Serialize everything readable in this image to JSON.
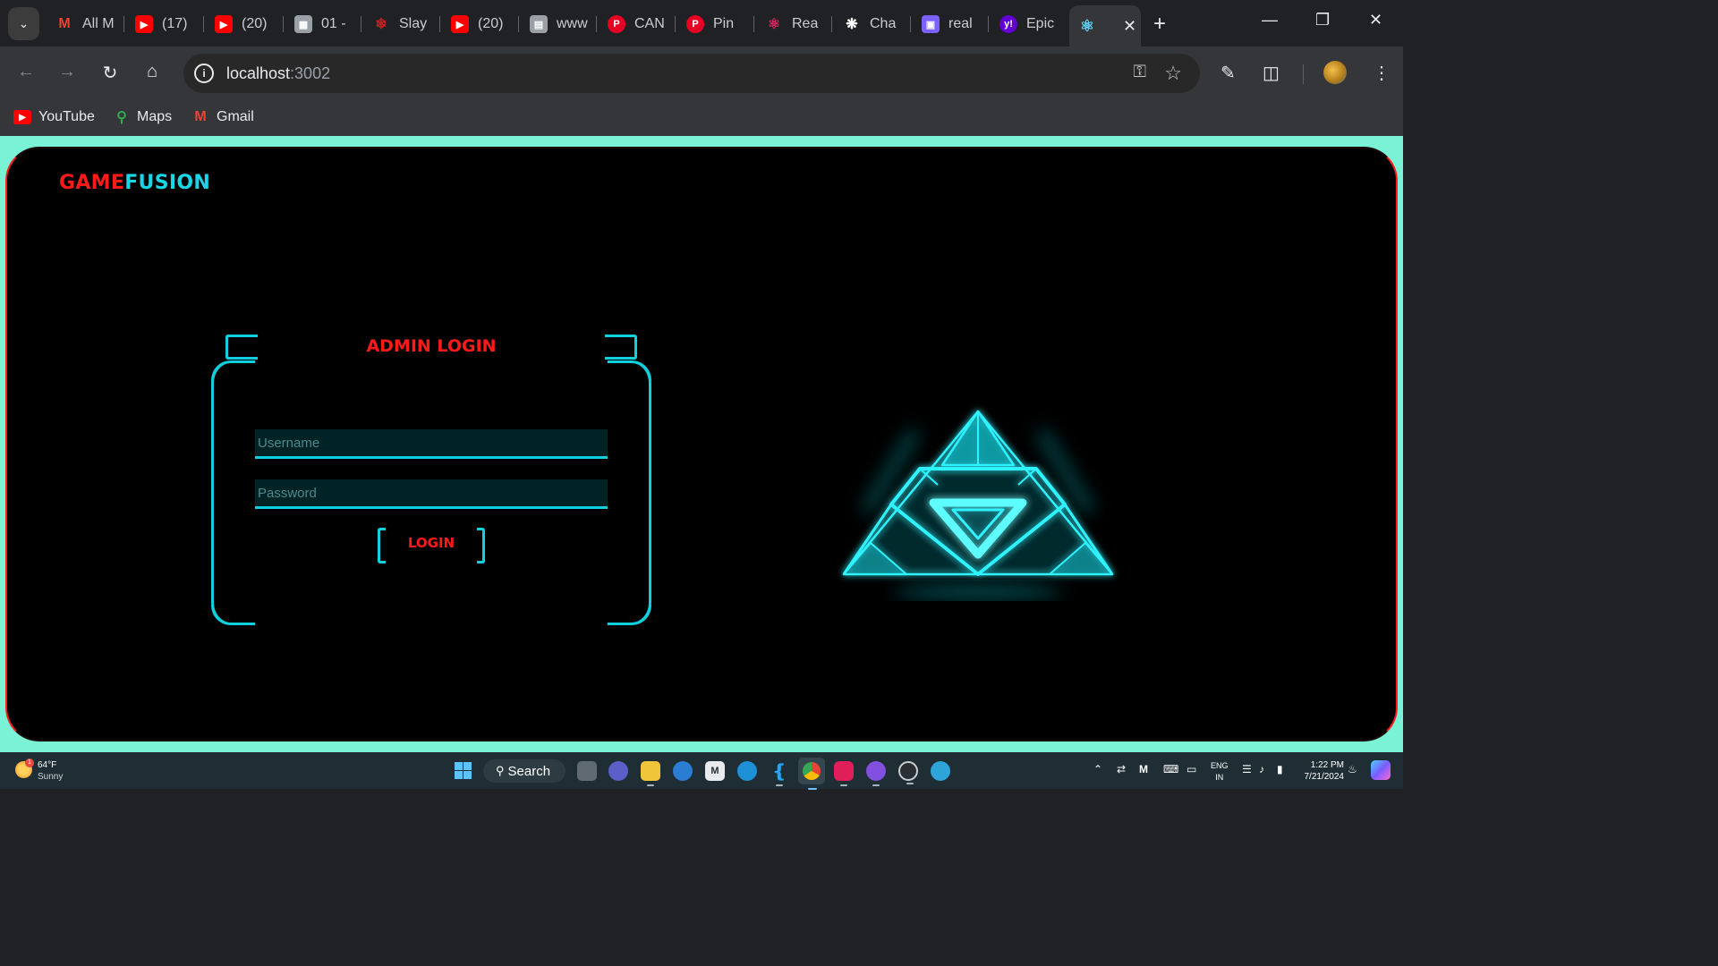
{
  "browser": {
    "tabs": [
      {
        "label": "All M",
        "icon": "gmail-icon",
        "color": "#ea4335"
      },
      {
        "label": "(17)",
        "icon": "youtube-icon",
        "color": "#ff0000"
      },
      {
        "label": "(20)",
        "icon": "youtube-icon",
        "color": "#ff0000"
      },
      {
        "label": "01 -",
        "icon": "storefront-icon",
        "color": "#9aa0a6"
      },
      {
        "label": "Slay",
        "icon": "slayer-icon",
        "color": "#c5221f"
      },
      {
        "label": "(20)",
        "icon": "youtube-icon",
        "color": "#ff0000"
      },
      {
        "label": "www",
        "icon": "page-icon",
        "color": "#9aa0a6"
      },
      {
        "label": "CAN",
        "icon": "pinterest-icon",
        "color": "#e60023"
      },
      {
        "label": "Pin",
        "icon": "pinterest-icon",
        "color": "#e60023"
      },
      {
        "label": "Rea",
        "icon": "react-icon",
        "color": "#e0245e"
      },
      {
        "label": "Cha",
        "icon": "chatgpt-icon",
        "color": "#ffffff"
      },
      {
        "label": "real",
        "icon": "app-icon",
        "color": "#7b61ff"
      },
      {
        "label": "Epic",
        "icon": "yahoo-icon",
        "color": "#6001d2"
      }
    ],
    "active_tab_icon": "react-icon",
    "url_host": "localhost",
    "url_port": ":3002",
    "bookmarks": [
      {
        "label": "YouTube",
        "icon": "youtube-icon",
        "color": "#ff0000"
      },
      {
        "label": "Maps",
        "icon": "maps-pin-icon",
        "color": "#34a853"
      },
      {
        "label": "Gmail",
        "icon": "gmail-icon",
        "color": "#ea4335"
      }
    ]
  },
  "page": {
    "logo_game": "GAME",
    "logo_fusion": "FUSION",
    "title": "ADMIN LOGIN",
    "username_placeholder": "Username",
    "password_placeholder": "Password",
    "login_label": "LOGIN",
    "colors": {
      "accent_cyan": "#0fd0dc",
      "accent_red": "#ff1a1a",
      "page_bg": "#79f2d6"
    }
  },
  "taskbar": {
    "weather_temp": "64°F",
    "weather_desc": "Sunny",
    "weather_badge": "1",
    "search_label": "Search",
    "lang_top": "ENG",
    "lang_bottom": "IN",
    "time": "1:22 PM",
    "date": "7/21/2024"
  }
}
